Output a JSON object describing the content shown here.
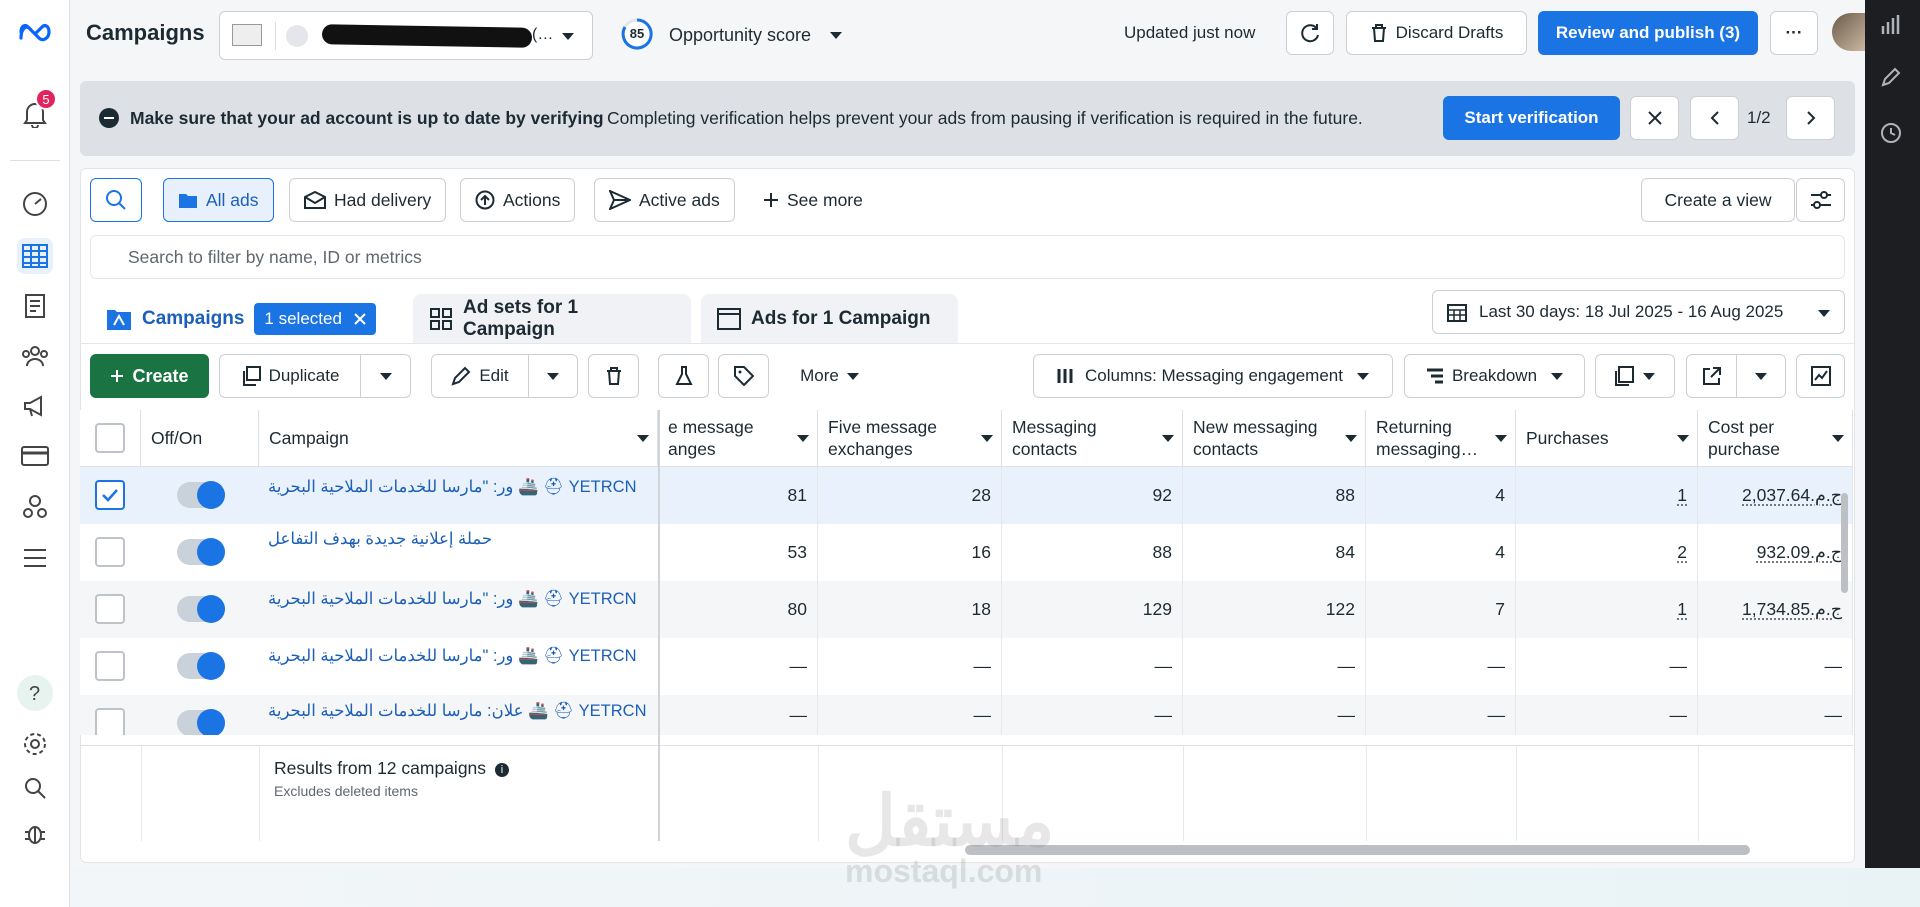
{
  "header": {
    "title": "Campaigns",
    "account_suffix": "(…",
    "opportunity_score": "85",
    "opportunity_label": "Opportunity score",
    "updated": "Updated just now",
    "discard": "Discard Drafts",
    "review_publish": "Review and publish (3)",
    "more": "···"
  },
  "leftrail": {
    "notifications_count": "5"
  },
  "banner": {
    "title": "Make sure that your ad account is up to date by verifying",
    "text": "Completing verification helps prevent your ads from pausing if verification is required in the future.",
    "button": "Start verification",
    "page": "1/2"
  },
  "filters": {
    "chips": [
      "All ads",
      "Had delivery",
      "Actions",
      "Active ads",
      "See more"
    ],
    "create_view": "Create a view",
    "search_placeholder": "Search to filter by name, ID or metrics"
  },
  "tabs": {
    "campaigns": "Campaigns",
    "selected": "1 selected",
    "ad_sets": "Ad sets for 1 Campaign",
    "ads": "Ads for 1 Campaign",
    "date_range": "Last 30 days: 18 Jul 2025 - 16 Aug 2025"
  },
  "toolbar": {
    "create": "Create",
    "duplicate": "Duplicate",
    "edit": "Edit",
    "more": "More",
    "columns": "Columns: Messaging engagement",
    "breakdown": "Breakdown"
  },
  "table": {
    "headers": {
      "offon": "Off/On",
      "campaign": "Campaign",
      "three_msg": [
        "e message",
        "anges"
      ],
      "five_msg": [
        "Five message",
        "exchanges"
      ],
      "messaging_contacts": [
        "Messaging",
        "contacts"
      ],
      "new_contacts": [
        "New messaging",
        "contacts"
      ],
      "returning": [
        "Returning",
        "messaging…"
      ],
      "purchases": "Purchases",
      "cost": [
        "Cost per",
        "purchase"
      ]
    },
    "rows": [
      {
        "name": "YETRCN ⛑ 🚢 ور: \"مارسا للخدمات الملاحية البحرية",
        "c1": "81",
        "c2": "28",
        "c3": "92",
        "c4": "88",
        "c5": "4",
        "c6": "1",
        "c7": "ج.م.2,037.64",
        "checked": true
      },
      {
        "name": "حملة إعلانية جديدة بهدف التفاعل",
        "c1": "53",
        "c2": "16",
        "c3": "88",
        "c4": "84",
        "c5": "4",
        "c6": "2",
        "c7": "ج.م.932.09",
        "checked": false
      },
      {
        "name": "YETRCN ⛑ 🚢 ور: \"مارسا للخدمات الملاحية البحرية",
        "c1": "80",
        "c2": "18",
        "c3": "129",
        "c4": "122",
        "c5": "7",
        "c6": "1",
        "c7": "ج.م.1,734.85",
        "checked": false
      },
      {
        "name": "YETRCN ⛑ 🚢 ور: \"مارسا للخدمات الملاحية البحرية",
        "c1": "—",
        "c2": "—",
        "c3": "—",
        "c4": "—",
        "c5": "—",
        "c6": "—",
        "c7": "—",
        "checked": false
      },
      {
        "name": "YETRCN ⛑ 🚢 علان: مارسا للخدمات الملاحية البحرية",
        "c1": "—",
        "c2": "—",
        "c3": "—",
        "c4": "—",
        "c5": "—",
        "c6": "—",
        "c7": "—",
        "checked": false
      }
    ],
    "footer": "Results from 12 campaigns",
    "footer_sub": "Excludes deleted items"
  },
  "watermark": {
    "ar": "مستقل",
    "en": "mostaql.com"
  },
  "colors": {
    "primary": "#1b74e4",
    "create": "#1a7342",
    "badge": "#e0245e",
    "rail_dark": "#1c1e21"
  }
}
